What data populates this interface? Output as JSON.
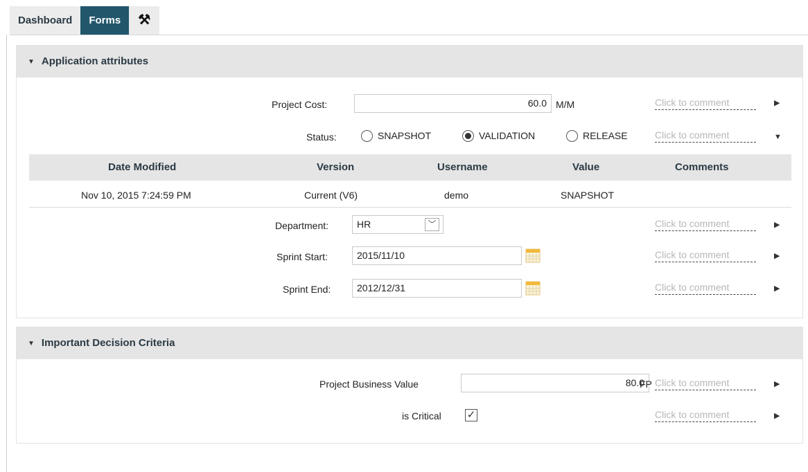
{
  "tabs": [
    {
      "label": "Dashboard"
    },
    {
      "label": "Forms"
    },
    {
      "icon": "tools-icon",
      "glyph": "⚒"
    }
  ],
  "colors": {
    "accent": "#21566b",
    "panel_header": "#e5e5e5"
  },
  "sections": {
    "app_attributes": {
      "title": "Application attributes",
      "project_cost": {
        "label": "Project Cost:",
        "value": "60.0",
        "unit": "M/M"
      },
      "status": {
        "label": "Status:",
        "options": [
          "SNAPSHOT",
          "VALIDATION",
          "RELEASE"
        ],
        "selected": "VALIDATION"
      },
      "history": {
        "headers": [
          "Date Modified",
          "Version",
          "Username",
          "Value",
          "Comments"
        ],
        "rows": [
          {
            "date": "Nov 10, 2015 7:24:59 PM",
            "version": "Current (V6)",
            "username": "demo",
            "value": "SNAPSHOT",
            "comments": ""
          }
        ]
      },
      "department": {
        "label": "Department:",
        "value": "HR"
      },
      "sprint_start": {
        "label": "Sprint Start:",
        "value": "2015/11/10"
      },
      "sprint_end": {
        "label": "Sprint End:",
        "value": "2012/12/31"
      }
    },
    "decision_criteria": {
      "title": "Important Decision Criteria",
      "business_value": {
        "label": "Project Business Value",
        "value": "80.0",
        "unit": "FP"
      },
      "is_critical": {
        "label": "is Critical",
        "checked": true,
        "check_glyph": "✓"
      }
    }
  },
  "comment_placeholder": "Click to comment"
}
